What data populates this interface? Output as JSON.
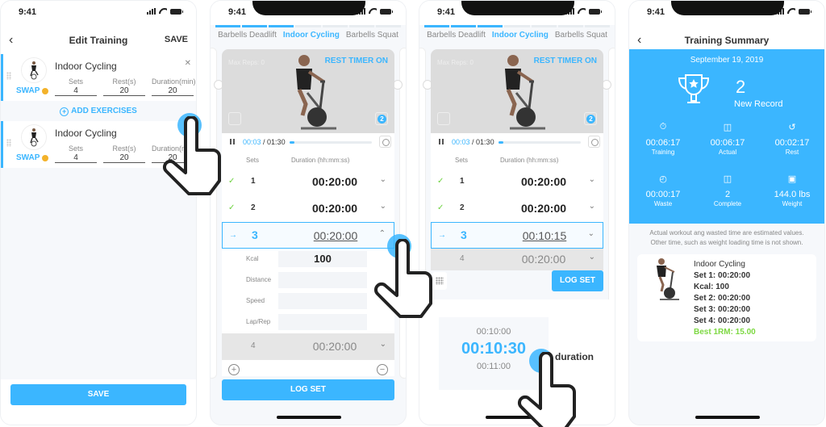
{
  "status_bar": {
    "time": "9:41"
  },
  "screens": {
    "edit_training": {
      "title": "Edit Training",
      "save_label": "SAVE",
      "back_icon": "chevron-left-icon",
      "exercises": [
        {
          "name": "Indoor Cycling",
          "swap": "SWAP",
          "fields": [
            {
              "label": "Sets",
              "value": "4"
            },
            {
              "label": "Rest(s)",
              "value": "20"
            },
            {
              "label": "Duration(min)",
              "value": "20"
            }
          ]
        },
        {
          "name": "Indoor Cycling",
          "swap": "SWAP",
          "fields": [
            {
              "label": "Sets",
              "value": "4"
            },
            {
              "label": "Rest(s)",
              "value": "20"
            },
            {
              "label": "Duration(min)",
              "value": "20"
            }
          ]
        }
      ],
      "add_exercises_label": "ADD EXERCISES",
      "bottom_save_label": "SAVE"
    },
    "workout_a": {
      "tabs": [
        "Barbells Deadlift",
        "Indoor Cycling",
        "Barbells Squat"
      ],
      "active_tab": "Indoor Cycling",
      "progress_segments_done": 3,
      "progress_segments_total": 7,
      "max_reps": "Max Reps: 0",
      "rest_timer": "REST TIMER ON",
      "set_badge": "2",
      "timer_current": "00:03",
      "timer_total": "/ 01:30",
      "timer_progress": 0.03,
      "col_sets": "Sets",
      "col_duration": "Duration (hh:mm:ss)",
      "sets": [
        {
          "num": "1",
          "duration": "00:20:00",
          "state": "done"
        },
        {
          "num": "2",
          "duration": "00:20:00",
          "state": "done"
        },
        {
          "num": "3",
          "duration": "00:20:00",
          "state": "current"
        },
        {
          "num": "4",
          "duration": "00:20:00",
          "state": "pending"
        }
      ],
      "details": [
        {
          "label": "Kcal",
          "value": "100"
        },
        {
          "label": "Distance",
          "value": ""
        },
        {
          "label": "Speed",
          "value": ""
        },
        {
          "label": "Lap/Rep",
          "value": ""
        }
      ],
      "log_set_label": "LOG SET"
    },
    "workout_b": {
      "tabs": [
        "Barbells Deadlift",
        "Indoor Cycling",
        "Barbells Squat"
      ],
      "max_reps": "Max Reps: 0",
      "rest_timer": "REST TIMER ON",
      "set_badge": "2",
      "timer_current": "00:03",
      "timer_total": "/ 01:30",
      "col_sets": "Sets",
      "col_duration": "Duration (hh:mm:ss)",
      "sets": [
        {
          "num": "1",
          "duration": "00:20:00",
          "state": "done"
        },
        {
          "num": "2",
          "duration": "00:20:00",
          "state": "done"
        },
        {
          "num": "3",
          "duration": "00:10:15",
          "state": "current"
        },
        {
          "num": "4",
          "duration": "00:20:00",
          "state": "pending"
        }
      ],
      "log_set_label": "LOG SET",
      "picker": {
        "above": "00:10:00",
        "selected": "00:10:30",
        "below": "00:11:00",
        "label": "duration"
      }
    },
    "summary": {
      "title": "Training Summary",
      "date": "September 19, 2019",
      "record_count": "2",
      "record_label": "New Record",
      "stats": [
        {
          "icon": "stopwatch-icon",
          "value": "00:06:17",
          "label": "Training"
        },
        {
          "icon": "dumbbell-clock-icon",
          "value": "00:06:17",
          "label": "Actual"
        },
        {
          "icon": "rest-clock-icon",
          "value": "00:02:17",
          "label": "Rest"
        },
        {
          "icon": "trash-clock-icon",
          "value": "00:00:17",
          "label": "Waste"
        },
        {
          "icon": "dumbbell-icon",
          "value": "2",
          "label": "Complete"
        },
        {
          "icon": "weight-icon",
          "value": "144.0 lbs",
          "label": "Weight"
        }
      ],
      "note_line1": "Actual workout ang wasted time are estimated values.",
      "note_line2": "Other time, such as weight loading time is not shown.",
      "card_lines": [
        "Indoor Cycling",
        "Set 1: 00:20:00",
        "Kcal: 100",
        "Set 2: 00:20:00",
        "Set 3: 00:20:00",
        "Set 4: 00:20:00"
      ],
      "best": "Best 1RM: 15.00"
    }
  },
  "colors": {
    "accent": "#3bb6ff",
    "done": "#6cd13e",
    "best": "#7dd842",
    "swap_gear": "#f3b22a"
  }
}
